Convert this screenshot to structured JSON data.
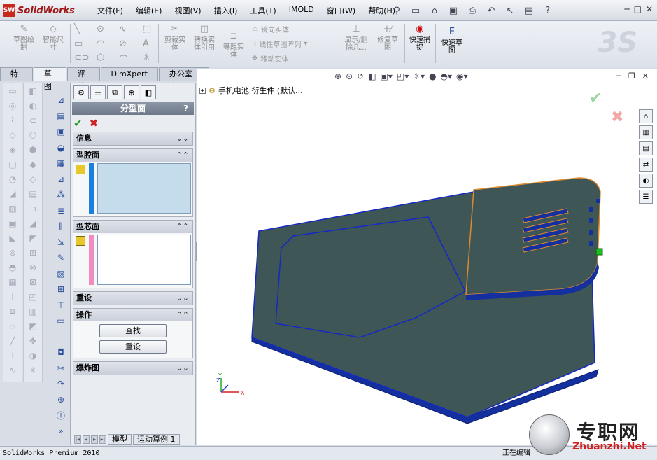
{
  "app": {
    "brand_short": "SW",
    "brand_name": "SolidWorks"
  },
  "menu": [
    "文件(F)",
    "编辑(E)",
    "视图(V)",
    "插入(I)",
    "工具(T)",
    "IMOLD",
    "窗口(W)",
    "帮助(H)"
  ],
  "commands": {
    "sketch": "草图绘制",
    "smart_dim": "智能尺寸",
    "trim": "剪裁实体",
    "convert": "转换实体引用",
    "offset": "等距实体",
    "mirror": "镜向实体",
    "linear_pattern": "线性草图阵列",
    "move": "移动实体",
    "show_hide": "显示/删除几...",
    "repair": "修复草图",
    "quick_snap": "快速捕捉",
    "quick_sketch": "快速草图"
  },
  "tabs": [
    "特征",
    "草图",
    "评估",
    "DimXpert",
    "办公室产品"
  ],
  "active_tab": "草图",
  "property_manager": {
    "title": "分型面",
    "help": "?",
    "groups": {
      "info": "信息",
      "cavity": "型腔面",
      "core": "型芯面",
      "reset": "重设",
      "operation": "操作",
      "exploded": "爆炸图"
    },
    "buttons": {
      "find": "查找",
      "reset": "重设"
    },
    "colors": {
      "cavity": "#1a7fe0",
      "core": "#f08cc0"
    }
  },
  "feature_tree": {
    "item": "手机电池 衍生件 (默认..."
  },
  "bottom_tabs": [
    "模型",
    "运动算例 1"
  ],
  "status": {
    "left": "SolidWorks Premium 2010",
    "right": "正在编辑"
  },
  "watermark": {
    "cn": "专职网",
    "en": "Zhuanzhi.Net"
  },
  "axes": {
    "x": "X",
    "y": "Y",
    "z": "Z"
  },
  "model_colors": {
    "body": "#3f5656",
    "edge": "#1428c8",
    "highlight": "#e08a30",
    "handle": "#22bb22"
  }
}
